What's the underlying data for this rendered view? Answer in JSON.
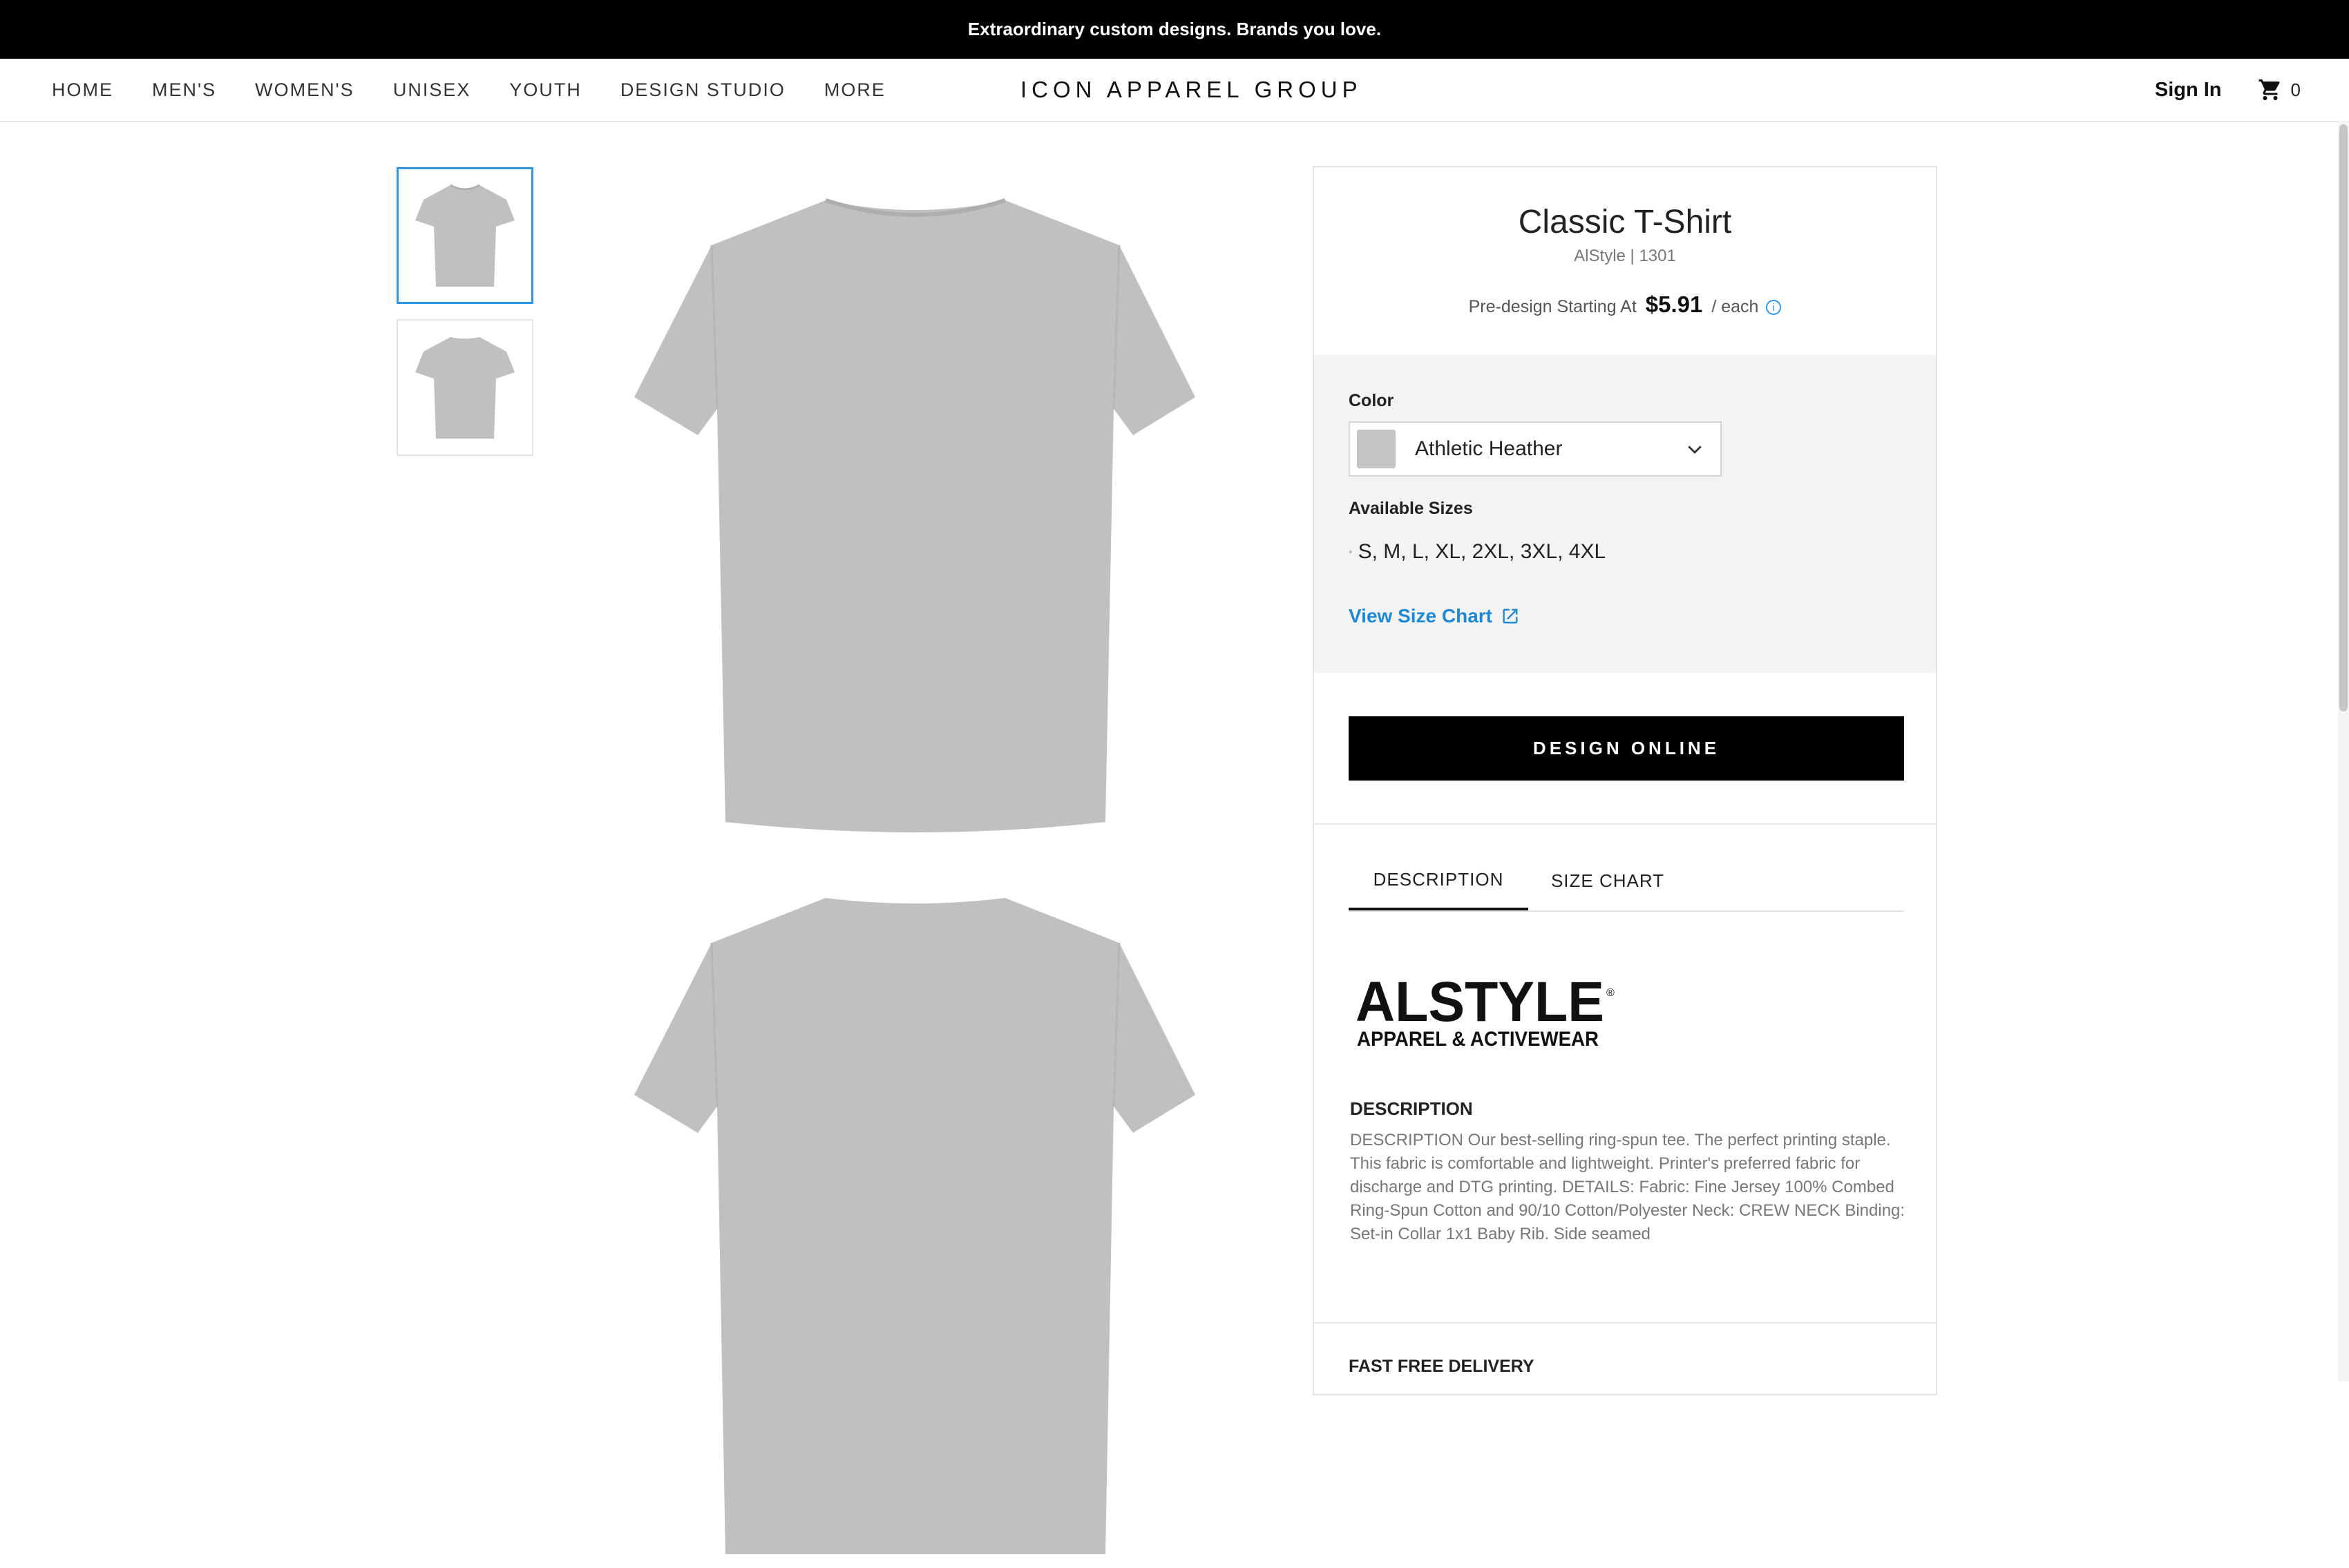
{
  "promo": {
    "text": "Extraordinary custom designs. Brands you love."
  },
  "nav": {
    "items": [
      "HOME",
      "MEN'S",
      "WOMEN'S",
      "UNISEX",
      "YOUTH",
      "DESIGN STUDIO",
      "MORE"
    ]
  },
  "brand": "ICON APPAREL GROUP",
  "header_right": {
    "sign_in": "Sign In",
    "cart_count": "0",
    "cart_icon": "cart-icon"
  },
  "gallery": {
    "thumbnails": [
      "tshirt-front-thumbnail",
      "tshirt-back-thumbnail"
    ],
    "images": [
      "tshirt-front-image",
      "tshirt-back-image"
    ],
    "shirt_color": "#c0c0c2"
  },
  "product": {
    "title": "Classic T-Shirt",
    "brand_sku": "AlStyle | 1301",
    "price_prefix": "Pre-design Starting At",
    "price": "$5.91",
    "price_suffix": "/ each",
    "info_icon": "i"
  },
  "options": {
    "color_label": "Color",
    "color_value": "Athletic Heather",
    "color_swatch": "#c4c4c4",
    "sizes_label": "Available Sizes",
    "sizes": "S, M, L, XL, 2XL, 3XL, 4XL",
    "size_chart_link": "View Size Chart"
  },
  "cta": {
    "design_online": "DESIGN ONLINE"
  },
  "tabs": {
    "description": "DESCRIPTION",
    "size_chart": "SIZE CHART"
  },
  "logo": {
    "name": "ALSTYLE",
    "tagline": "APPAREL & ACTIVEWEAR",
    "mark": "®"
  },
  "description": {
    "heading": "DESCRIPTION",
    "body": "DESCRIPTION Our best-selling ring-spun tee. The perfect printing staple. This fabric is comfortable and lightweight. Printer's preferred fabric for discharge and DTG printing. DETAILS: Fabric: Fine Jersey 100% Combed Ring-Spun Cotton and 90/10 Cotton/Polyester Neck: CREW NECK Binding: Set-in Collar 1x1 Baby Rib. Side seamed"
  },
  "delivery": {
    "heading": "FAST FREE DELIVERY"
  },
  "colors": {
    "accent": "#2f96e6",
    "link": "#1e88d6",
    "button": "#000000"
  }
}
